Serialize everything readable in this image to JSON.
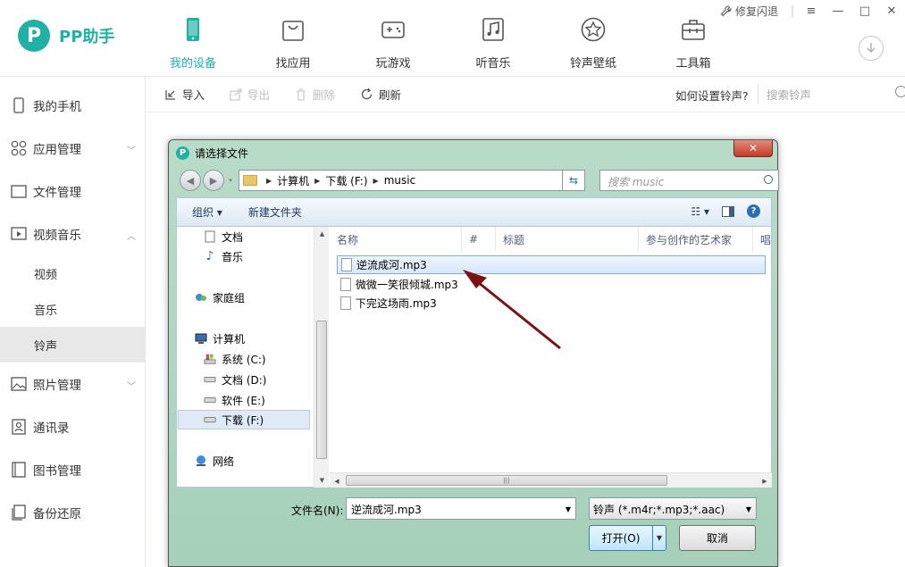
{
  "app": {
    "name": "PP助手",
    "repair_label": "修复闪退"
  },
  "nav": [
    {
      "label": "我的设备",
      "icon": "phone-icon",
      "active": true
    },
    {
      "label": "找应用",
      "icon": "bag-icon"
    },
    {
      "label": "玩游戏",
      "icon": "gamepad-icon"
    },
    {
      "label": "听音乐",
      "icon": "music-note-icon"
    },
    {
      "label": "铃声壁纸",
      "icon": "star-icon"
    },
    {
      "label": "工具箱",
      "icon": "toolbox-icon"
    }
  ],
  "sidebar": {
    "items": [
      {
        "label": "我的手机",
        "icon": "phone-outline-icon"
      },
      {
        "label": "应用管理",
        "icon": "apps-grid-icon"
      },
      {
        "label": "文件管理",
        "icon": "folder-icon"
      },
      {
        "label": "视频音乐",
        "icon": "video-play-icon"
      },
      {
        "label": "照片管理",
        "icon": "image-icon"
      },
      {
        "label": "通讯录",
        "icon": "contact-icon"
      },
      {
        "label": "图书管理",
        "icon": "book-icon"
      },
      {
        "label": "备份还原",
        "icon": "backup-icon"
      }
    ],
    "sub_items": [
      {
        "label": "视频"
      },
      {
        "label": "音乐"
      },
      {
        "label": "铃声",
        "active": true
      }
    ]
  },
  "toolbar": {
    "import": "导入",
    "export": "导出",
    "delete": "删除",
    "refresh": "刷新",
    "help": "如何设置铃声?",
    "search_placeholder": "搜索铃声"
  },
  "dialog": {
    "title": "请选择文件",
    "close": "✕",
    "path": [
      "计算机",
      "下载 (F:)",
      "music"
    ],
    "search_placeholder": "搜索 music",
    "organize": "组织 ▾",
    "new_folder": "新建文件夹",
    "tree": [
      {
        "label": "文档",
        "icon": "document-icon"
      },
      {
        "label": "音乐",
        "icon": "music-icon"
      },
      {
        "label": "家庭组",
        "icon": "homegroup-icon"
      },
      {
        "label": "计算机",
        "icon": "computer-icon"
      },
      {
        "label": "系统 (C:)",
        "icon": "drive-c-icon"
      },
      {
        "label": "文档 (D:)",
        "icon": "drive-icon"
      },
      {
        "label": "软件 (E:)",
        "icon": "drive-icon"
      },
      {
        "label": "下载 (F:)",
        "icon": "drive-icon",
        "selected": true
      },
      {
        "label": "网络",
        "icon": "network-icon"
      }
    ],
    "columns": [
      "名称",
      "#",
      "标题",
      "参与创作的艺术家",
      "唱"
    ],
    "files": [
      {
        "name": "逆流成河.mp3",
        "selected": true
      },
      {
        "name": "微微一笑很倾城.mp3"
      },
      {
        "name": "下完这场雨.mp3"
      }
    ],
    "filename_label": "文件名(N):",
    "filename_value": "逆流成河.mp3",
    "filetype_value": "铃声 (*.m4r;*.mp3;*.aac)",
    "open_label": "打开(O)",
    "cancel_label": "取消"
  },
  "colors": {
    "brand": "#1fb0a6",
    "annotation_arrow": "#7a1414"
  }
}
